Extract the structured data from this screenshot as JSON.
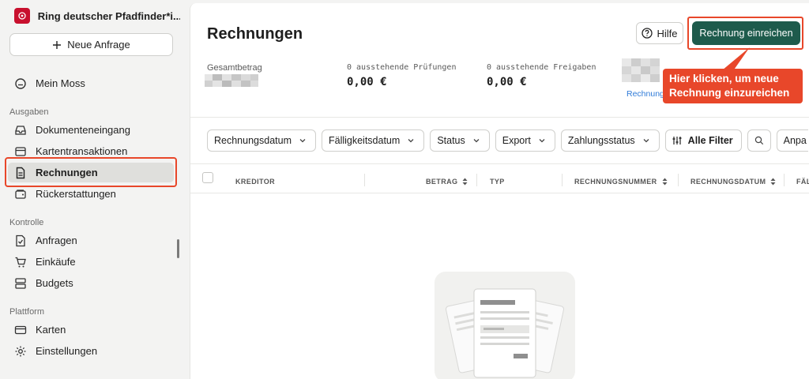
{
  "sidebar": {
    "org_name": "Ring deutscher Pfadfinder*i...",
    "new_request": "Neue Anfrage",
    "home": "Mein Moss",
    "sections": {
      "ausgaben": "Ausgaben",
      "kontrolle": "Kontrolle",
      "plattform": "Plattform"
    },
    "items": {
      "dokumenteneingang": "Dokumenteneingang",
      "kartentransaktionen": "Kartentransaktionen",
      "rechnungen": "Rechnungen",
      "rueckerstattungen": "Rückerstattungen",
      "anfragen": "Anfragen",
      "einkaeufe": "Einkäufe",
      "budgets": "Budgets",
      "karten": "Karten",
      "einstellungen": "Einstellungen"
    }
  },
  "header": {
    "title": "Rechnungen",
    "help": "Hilfe",
    "submit": "Rechnung einreichen"
  },
  "stats": {
    "total_label": "Gesamtbetrag",
    "reviews_label": "0 ausstehende Prüfungen",
    "reviews_value": "0,00 €",
    "approvals_label": "0 ausstehende Freigaben",
    "approvals_value": "0,00 €",
    "link_label": "Rechnung"
  },
  "callout": "Hier klicken, um neue Rechnung einzureichen",
  "filters": {
    "invoice_date": "Rechnungsdatum",
    "due_date": "Fälligkeitsdatum",
    "status": "Status",
    "export": "Export",
    "payment_status": "Zahlungsstatus",
    "all_filters": "Alle Filter",
    "adjust": "Anpa"
  },
  "table": {
    "creditor": "KREDITOR",
    "amount": "BETRAG",
    "type": "TYP",
    "invoice_number": "RECHNUNGSNUMMER",
    "invoice_date": "RECHNUNGSDATUM",
    "due": "FÄLL"
  },
  "colors": {
    "accent": "#1e5b4c",
    "highlight": "#e8472a",
    "link": "#2f7bd8",
    "logo": "#c8102e"
  }
}
